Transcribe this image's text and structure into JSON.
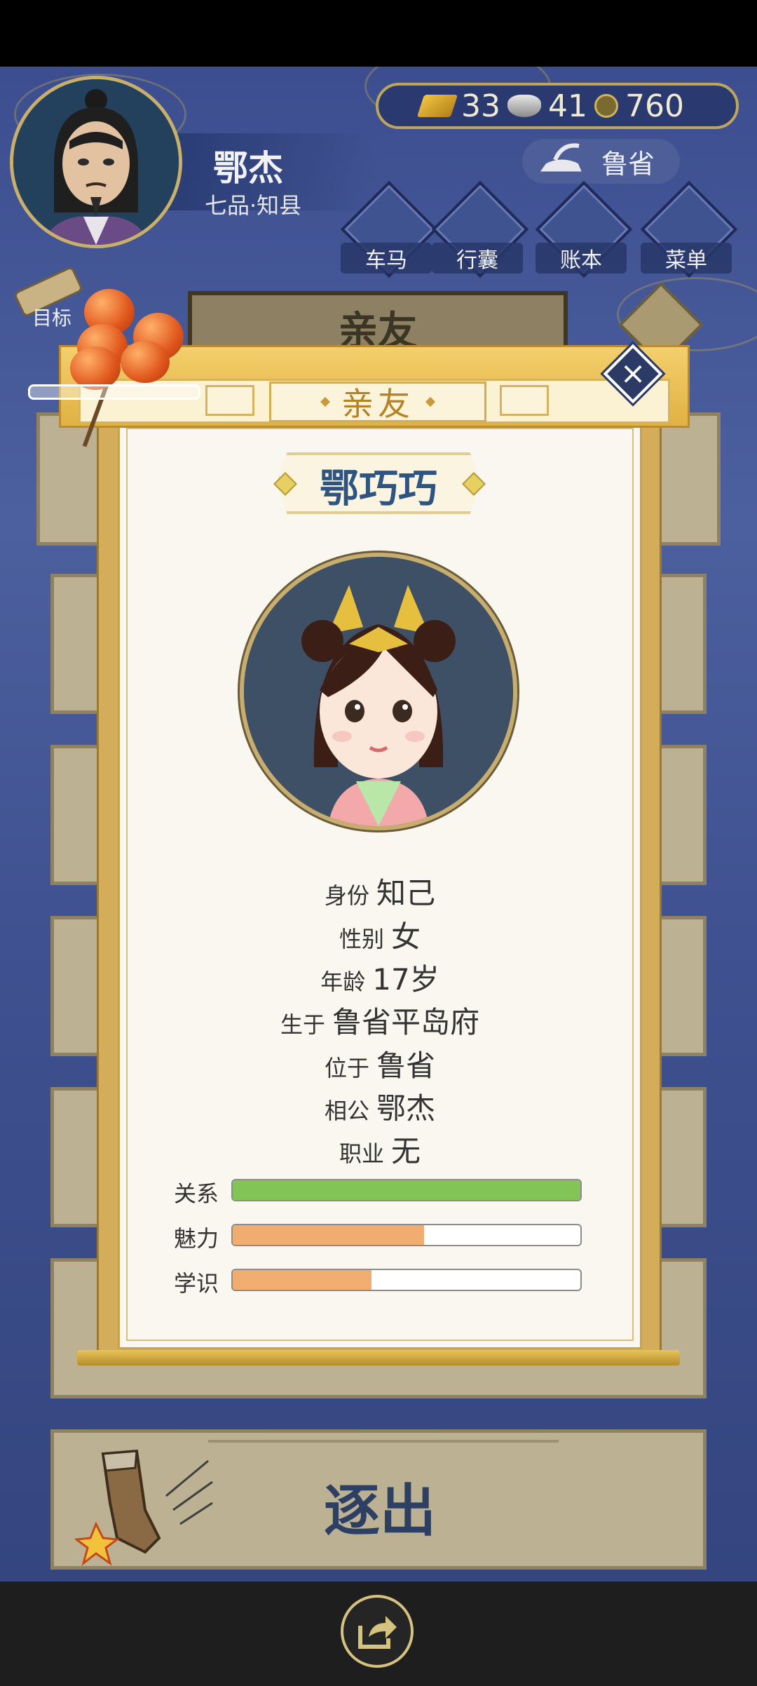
{
  "header": {
    "player_name": "鄂杰",
    "player_rank": "七品·知县",
    "currency": {
      "gold": "33",
      "silver": "41",
      "coins": "760"
    },
    "region": "鲁省"
  },
  "menu": [
    {
      "label": "车马",
      "icon": "carriage-icon"
    },
    {
      "label": "行囊",
      "icon": "bag-icon"
    },
    {
      "label": "账本",
      "icon": "ledger-icon"
    },
    {
      "label": "菜单",
      "icon": "more-icon"
    }
  ],
  "goal_label": "目标",
  "background_title": "亲友",
  "modal": {
    "title": "亲友",
    "character_name": "鄂巧巧",
    "info": [
      {
        "key": "身份",
        "value": "知己"
      },
      {
        "key": "性别",
        "value": "女"
      },
      {
        "key": "年龄",
        "value": "17岁"
      },
      {
        "key": "生于",
        "value": "鲁省平岛府"
      },
      {
        "key": "位于",
        "value": "鲁省"
      },
      {
        "key": "相公",
        "value": "鄂杰"
      },
      {
        "key": "职业",
        "value": "无"
      }
    ],
    "stats": [
      {
        "label": "关系",
        "fraction": 1.0,
        "color": "#82c456"
      },
      {
        "label": "魅力",
        "fraction": 0.55,
        "color": "#f0ad6f"
      },
      {
        "label": "学识",
        "fraction": 0.4,
        "color": "#f0ad6f"
      }
    ]
  },
  "expel_label": "逐出"
}
